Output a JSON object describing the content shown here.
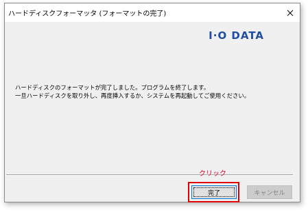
{
  "window": {
    "title": "ハードディスクフォーマッタ (フォーマットの完了)",
    "close_glyph": "×"
  },
  "brand": {
    "logo_text": "I·O DATA",
    "color": "#1e4da2"
  },
  "message": {
    "line1": "ハードディスクのフォーマットが完了しました。プログラムを終了します。",
    "line2": "一旦ハードディスクを取り外し、再度挿入するか、システムを再起動してご使用ください。"
  },
  "annotation": {
    "text": "クリック",
    "color": "#e8002a"
  },
  "buttons": {
    "finish_label": "完了",
    "cancel_label": "キャンセル"
  }
}
